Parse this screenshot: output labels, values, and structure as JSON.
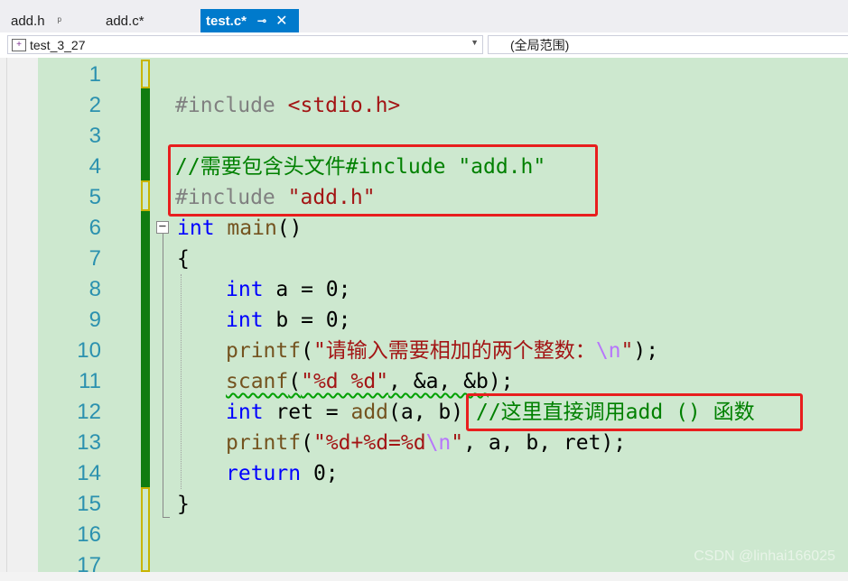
{
  "tabs": [
    {
      "label": "add.h",
      "pin": "ᵖ",
      "active": false
    },
    {
      "label": "add.c*",
      "active": false
    },
    {
      "label": "test.c*",
      "pin": "⊸",
      "close": "✕",
      "active": true
    }
  ],
  "navbar": {
    "project": "test_3_27",
    "scope": "(全局范围)"
  },
  "editor": {
    "line_numbers": [
      "1",
      "2",
      "3",
      "4",
      "5",
      "6",
      "7",
      "8",
      "9",
      "10",
      "11",
      "12",
      "13",
      "14",
      "15",
      "16",
      "17"
    ],
    "code": {
      "l2_directive": "#include",
      "l2_header": "<stdio.h>",
      "l4_comment": "//需要包含头文件#include \"add.h\"",
      "l5_directive": "#include",
      "l5_header": "\"add.h\"",
      "l6_type": "int",
      "l6_fn": "main",
      "l6_parens": "()",
      "l7_brace": "{",
      "l8_type": "int",
      "l8_rest": " a = 0;",
      "l9_type": "int",
      "l9_rest": " b = 0;",
      "l10_fn": "printf",
      "l10_open": "(",
      "l10_str": "\"请输入需要相加的两个整数：",
      "l10_esc": "\\n",
      "l10_str_end": "\"",
      "l10_close": ");",
      "l11_fn": "scanf",
      "l11_open": "(",
      "l11_str": "\"%d %d\"",
      "l11_args": ", &a, &b",
      "l11_close": ");",
      "l12_type": "int",
      "l12_rest1": " ret = ",
      "l12_fn": "add",
      "l12_args": "(a, b)",
      "l12_comment": "//这里直接调用add () 函数",
      "l13_fn": "printf",
      "l13_open": "(",
      "l13_str": "\"%d+%d=%d",
      "l13_esc": "\\n",
      "l13_str_end": "\"",
      "l13_args": ", a, b, ret);",
      "l14_kw": "return",
      "l14_rest": " 0;",
      "l15_brace": "}"
    },
    "fold_toggle": "−"
  },
  "watermark": "CSDN @linhai166025"
}
